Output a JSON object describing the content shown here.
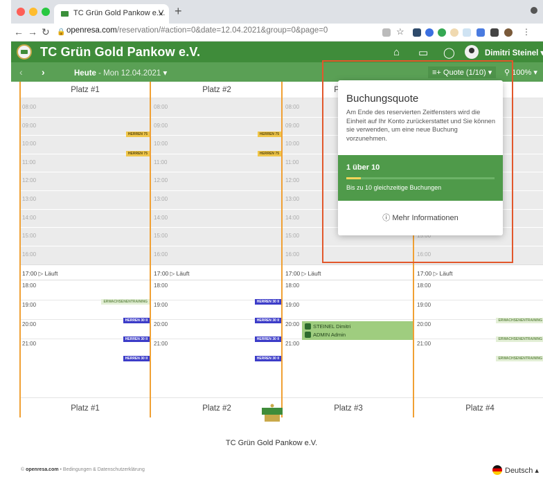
{
  "browser": {
    "tab_title": "TC Grün Gold Pankow e.V.",
    "url_host": "openresa.com",
    "url_path": "/reservation/#action=0&date=12.04.2021&group=0&page=0"
  },
  "app": {
    "club_name": "TC Grün Gold Pankow e.V.",
    "user_name": "Dimitri Steinel"
  },
  "subbar": {
    "today_label": "Heute",
    "date": " - Mon 12.04.2021",
    "quota_label": "Quote (1/10)",
    "zoom_label": "100%"
  },
  "courts": [
    {
      "name": "Platz #1"
    },
    {
      "name": "Platz #2"
    },
    {
      "name": "Platz #3"
    },
    {
      "name": "Platz #4"
    }
  ],
  "closed_hours": [
    "08:00",
    "09:00",
    "10:00",
    "11:00",
    "12:00",
    "13:00",
    "14:00",
    "15:00",
    "16:00"
  ],
  "now_row": {
    "time": "17:00",
    "label": "Läuft"
  },
  "open_hours": [
    "18:00",
    "19:00",
    "20:00",
    "21:00"
  ],
  "tags": {
    "herren75": "HERREN 75",
    "herren30": "HERREN 30 II",
    "erwachsenen": "ERWACHSENENTRAINING"
  },
  "booking": {
    "line1": "STEINEL Dimitri",
    "line2": "ADMIN Admin"
  },
  "popup": {
    "title": "Buchungsquote",
    "description": "Am Ende des reservierten Zeitfensters wird die Einheit auf Ihr Konto zurückerstattet und Sie können sie verwenden, um eine neue Buchung vorzunehmen.",
    "count_label": "1 über 10",
    "progress_fraction": 0.1,
    "limit_text": "Bis zu 10 gleichzeitige Buchungen",
    "more_info": "Mehr Informationen"
  },
  "footer": {
    "club_name": "TC Grün Gold Pankow e.V.",
    "copyright_host": "openresa.com",
    "links": " • Bedingungen & Datenschutzerklärung",
    "language": "Deutsch"
  },
  "colors": {
    "brand_green": "#3f8c3a",
    "accent_orange": "#f0a033",
    "highlight_red": "#e2572b"
  }
}
